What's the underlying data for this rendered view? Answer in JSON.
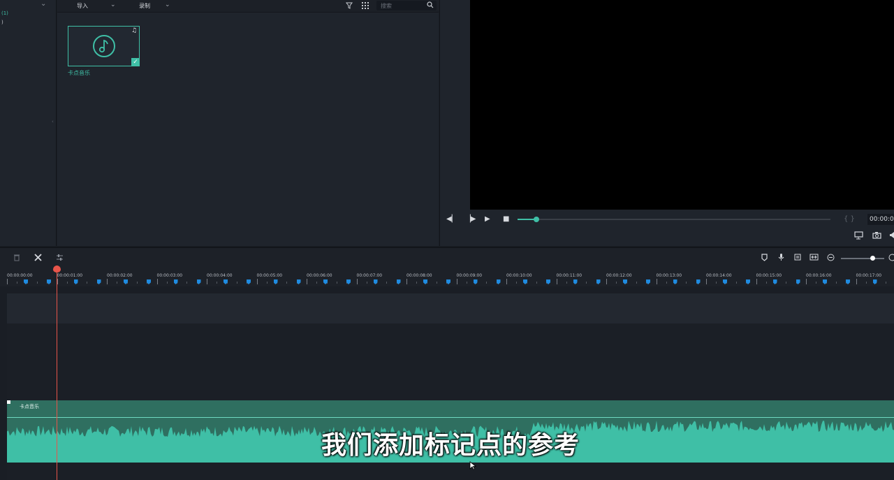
{
  "left_panel": {
    "item1": "(1)",
    "item2": ")"
  },
  "media": {
    "toolbar": {
      "import_label": "导入",
      "record_label": "录制",
      "search_placeholder": "搜索"
    },
    "items": [
      {
        "name": "卡点音乐",
        "type": "audio",
        "selected": true
      }
    ]
  },
  "preview": {
    "timecode": "00:00:0",
    "seek_progress_percent": 6
  },
  "timeline": {
    "ruler_labels": [
      "00:00:00:00",
      "00:00:01:00",
      "00:00:02:00",
      "00:00:03:00",
      "00:00:04:00",
      "00:00:05:00",
      "00:00:06:00",
      "00:00:07:00",
      "00:00:08:00",
      "00:00:09:00",
      "00:00:10:00",
      "00:00:11:00",
      "00:00:12:00",
      "00:00:13:00",
      "00:00:14:00",
      "00:00:15:00",
      "00:00:16:00",
      "00:00:17:00"
    ],
    "audio_clip_label": "卡点音乐"
  },
  "subtitle": "我们添加标记点的参考",
  "colors": {
    "accent": "#3fbfa6",
    "marker": "#1f8be0",
    "playhead": "#e8554a",
    "audio_track": "#2f6f60"
  }
}
